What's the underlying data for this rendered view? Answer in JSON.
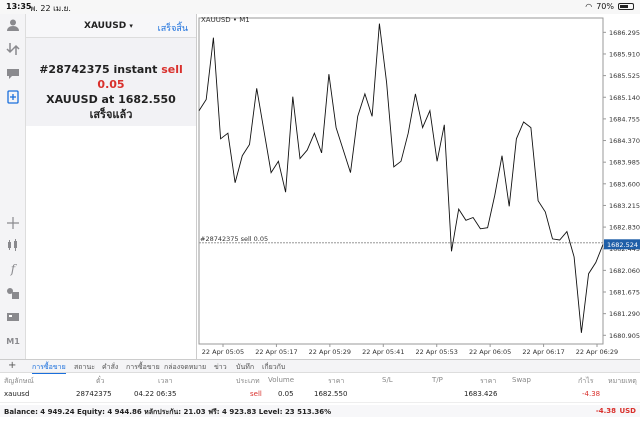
{
  "status_bar": {
    "time": "13:35",
    "date": "พ. 22 เม.ย.",
    "battery": "70%",
    "battery_level": 0.7
  },
  "order_panel": {
    "symbol": "XAUUSD",
    "done_label": "เสร็จสิ้น",
    "line1_prefix": "#28742375 instant ",
    "line1_sell": "sell 0.05",
    "line2": "XAUUSD at 1682.550",
    "line3": "เสร็จแล้ว"
  },
  "chart": {
    "title": "XAUUSD • M1",
    "order_line_label": "#28742375 sell 0.05",
    "current_price_label": "1682.524",
    "colors": {
      "line": "#111111",
      "grid": "#d6d6d6",
      "price_box": "#1f5fa8",
      "order_line": "#888888"
    }
  },
  "chart_data": {
    "type": "line",
    "title": "XAUUSD • M1",
    "xlabel": "",
    "ylabel": "",
    "ylim": [
      1680.75,
      1686.55
    ],
    "x_ticks": [
      "22 Apr 05:05",
      "22 Apr 05:17",
      "22 Apr 05:29",
      "22 Apr 05:41",
      "22 Apr 05:53",
      "22 Apr 06:05",
      "22 Apr 06:17",
      "22 Apr 06:29"
    ],
    "y_ticks": [
      1686.295,
      1685.91,
      1685.525,
      1685.14,
      1684.755,
      1684.37,
      1683.985,
      1683.6,
      1683.215,
      1682.83,
      1682.445,
      1682.06,
      1681.675,
      1681.29,
      1680.905
    ],
    "order_line_value": 1682.55,
    "current_price": 1682.524,
    "series": [
      {
        "values": [
          1684.9,
          1685.1,
          1686.2,
          1684.4,
          1684.5,
          1683.62,
          1684.1,
          1684.3,
          1685.3,
          1684.55,
          1683.8,
          1684.0,
          1683.45,
          1685.15,
          1684.05,
          1684.2,
          1684.5,
          1684.15,
          1685.55,
          1684.6,
          1684.2,
          1683.8,
          1684.8,
          1685.2,
          1684.8,
          1686.45,
          1685.4,
          1683.9,
          1684.0,
          1684.5,
          1685.2,
          1684.6,
          1684.9,
          1684.0,
          1684.65,
          1682.4,
          1683.15,
          1682.95,
          1683.0,
          1682.8,
          1682.82,
          1683.4,
          1684.1,
          1683.2,
          1684.4,
          1684.7,
          1684.6,
          1683.3,
          1683.1,
          1682.62,
          1682.6,
          1682.75,
          1682.3,
          1680.95,
          1682.0,
          1682.2,
          1682.52
        ]
      }
    ]
  },
  "tabs": [
    {
      "label": "การซื้อขาย",
      "active": true
    },
    {
      "label": "สถานะ",
      "active": false
    },
    {
      "label": "คำสั่ง",
      "active": false
    },
    {
      "label": "การซื้อขาย",
      "active": false
    },
    {
      "label": "กล่องจดหมาย",
      "active": false
    },
    {
      "label": "ข่าว",
      "active": false
    },
    {
      "label": "บันทึก",
      "active": false
    },
    {
      "label": "เกี่ยวกับ",
      "active": false
    }
  ],
  "table": {
    "headers": {
      "symbol": "สัญลักษณ์",
      "ticket": "ตั๋ว",
      "time": "เวลา",
      "type": "ประเภท",
      "volume": "Volume",
      "price": "ราคา",
      "sl": "S/L",
      "tp": "T/P",
      "price2": "ราคา",
      "swap": "Swap",
      "profit": "กำไร",
      "comment": "หมายเหตุ"
    },
    "row": {
      "symbol": "xauusd",
      "ticket": "28742375",
      "time": "04.22 06:35",
      "type": "sell",
      "volume": "0.05",
      "price": "1682.550",
      "price2": "1683.426",
      "profit": "-4.38"
    }
  },
  "balance": {
    "text": "Balance: 4 949.24 Equity: 4 944.86 หลักประกัน: 21.03 ฟรี: 4 923.83 Level: 23 513.36%",
    "profit": "-4.38",
    "currency": "USD"
  }
}
